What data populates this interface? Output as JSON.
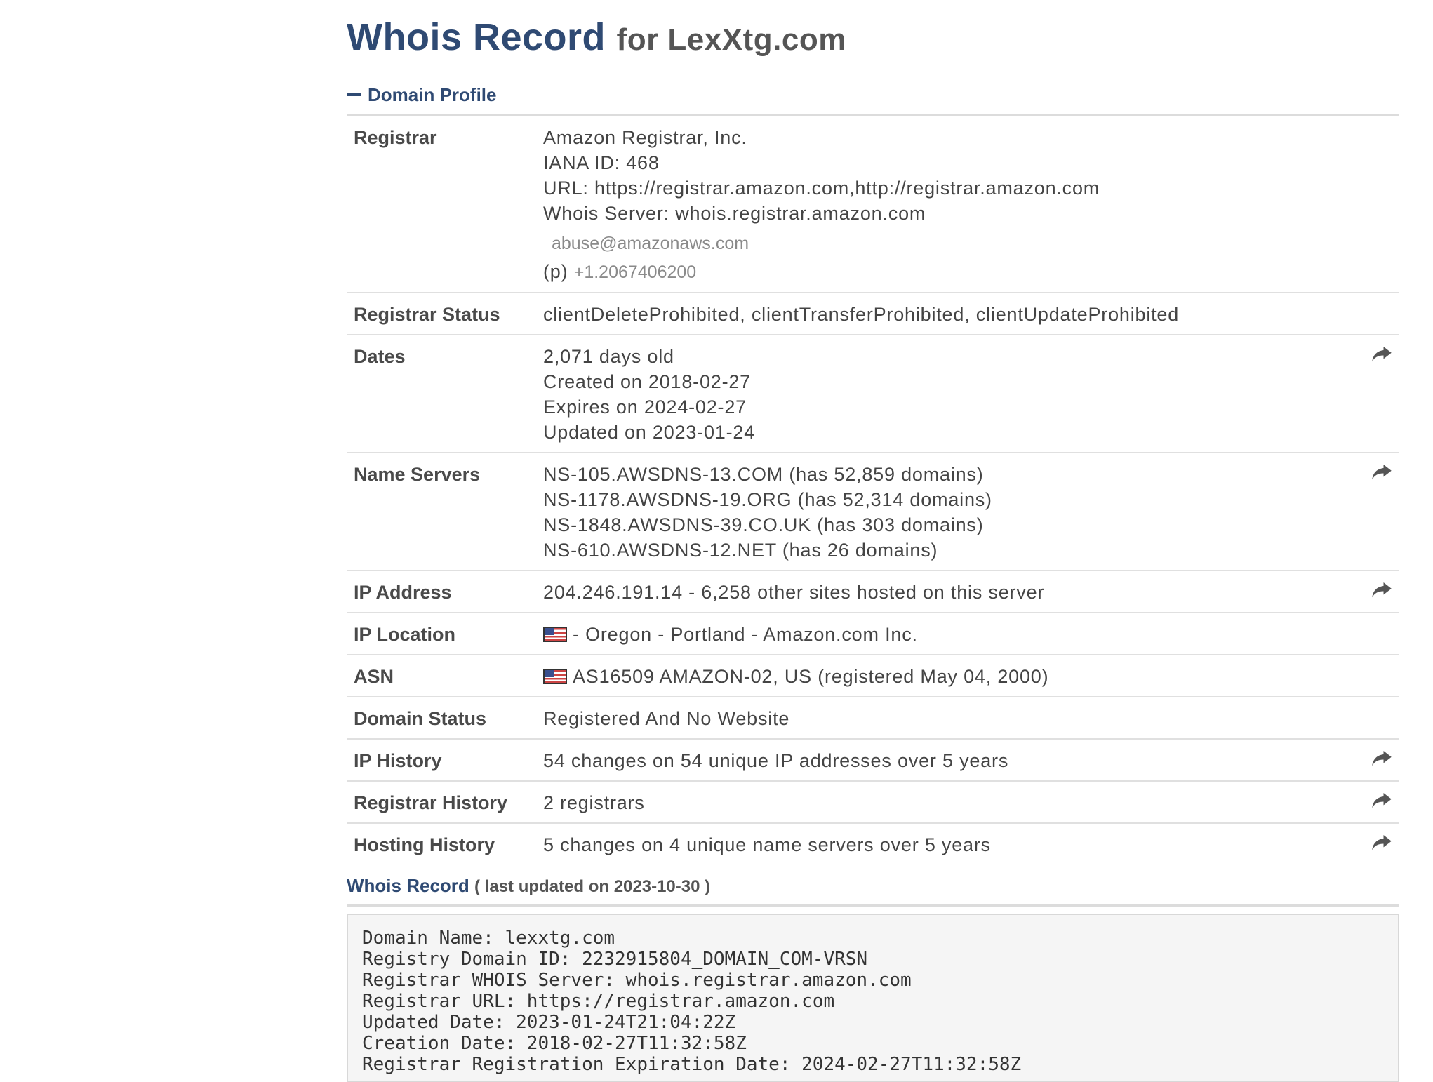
{
  "header": {
    "title": "Whois Record",
    "subtitle": "for LexXtg.com"
  },
  "profile": {
    "section_label": "Domain Profile",
    "registrar": {
      "label": "Registrar",
      "name": "Amazon Registrar, Inc.",
      "iana": "IANA ID: 468",
      "url": "URL: https://registrar.amazon.com,http://registrar.amazon.com",
      "whois_server": "Whois Server: whois.registrar.amazon.com",
      "email": "abuse@amazonaws.com",
      "phone_prefix": "(p)",
      "phone": "+1.2067406200"
    },
    "registrar_status": {
      "label": "Registrar Status",
      "value": "clientDeleteProhibited, clientTransferProhibited, clientUpdateProhibited"
    },
    "dates": {
      "label": "Dates",
      "age": "2,071 days old",
      "created": "Created on 2018-02-27",
      "expires": "Expires on 2024-02-27",
      "updated": "Updated on 2023-01-24"
    },
    "name_servers": {
      "label": "Name Servers",
      "items": [
        "NS-105.AWSDNS-13.COM (has 52,859 domains)",
        "NS-1178.AWSDNS-19.ORG (has 52,314 domains)",
        "NS-1848.AWSDNS-39.CO.UK (has 303 domains)",
        "NS-610.AWSDNS-12.NET (has 26 domains)"
      ]
    },
    "ip_address": {
      "label": "IP Address",
      "value": "204.246.191.14 - 6,258 other sites hosted on this server"
    },
    "ip_location": {
      "label": "IP Location",
      "value": "- Oregon - Portland - Amazon.com Inc."
    },
    "asn": {
      "label": "ASN",
      "value": "AS16509 AMAZON-02, US (registered May 04, 2000)"
    },
    "domain_status": {
      "label": "Domain Status",
      "value": "Registered And No Website"
    },
    "ip_history": {
      "label": "IP History",
      "value": "54 changes on 54 unique IP addresses over 5 years"
    },
    "registrar_history": {
      "label": "Registrar History",
      "value": "2 registrars"
    },
    "hosting_history": {
      "label": "Hosting History",
      "value": "5 changes on 4 unique name servers over 5 years"
    }
  },
  "whois_record": {
    "label": "Whois Record",
    "note": "( last updated on 2023-10-30 )",
    "lines": [
      "Domain Name: lexxtg.com",
      "Registry Domain ID: 2232915804_DOMAIN_COM-VRSN",
      "Registrar WHOIS Server: whois.registrar.amazon.com",
      "Registrar URL: https://registrar.amazon.com",
      "Updated Date: 2023-01-24T21:04:22Z",
      "Creation Date: 2018-02-27T11:32:58Z",
      "Registrar Registration Expiration Date: 2024-02-27T11:32:58Z"
    ]
  },
  "icons": {
    "share": "share-arrow-icon",
    "flag": "us-flag-icon",
    "collapse": "minus-icon"
  },
  "colors": {
    "accent": "#2f4a73",
    "text": "#444444",
    "rule": "#dcdcdc"
  }
}
